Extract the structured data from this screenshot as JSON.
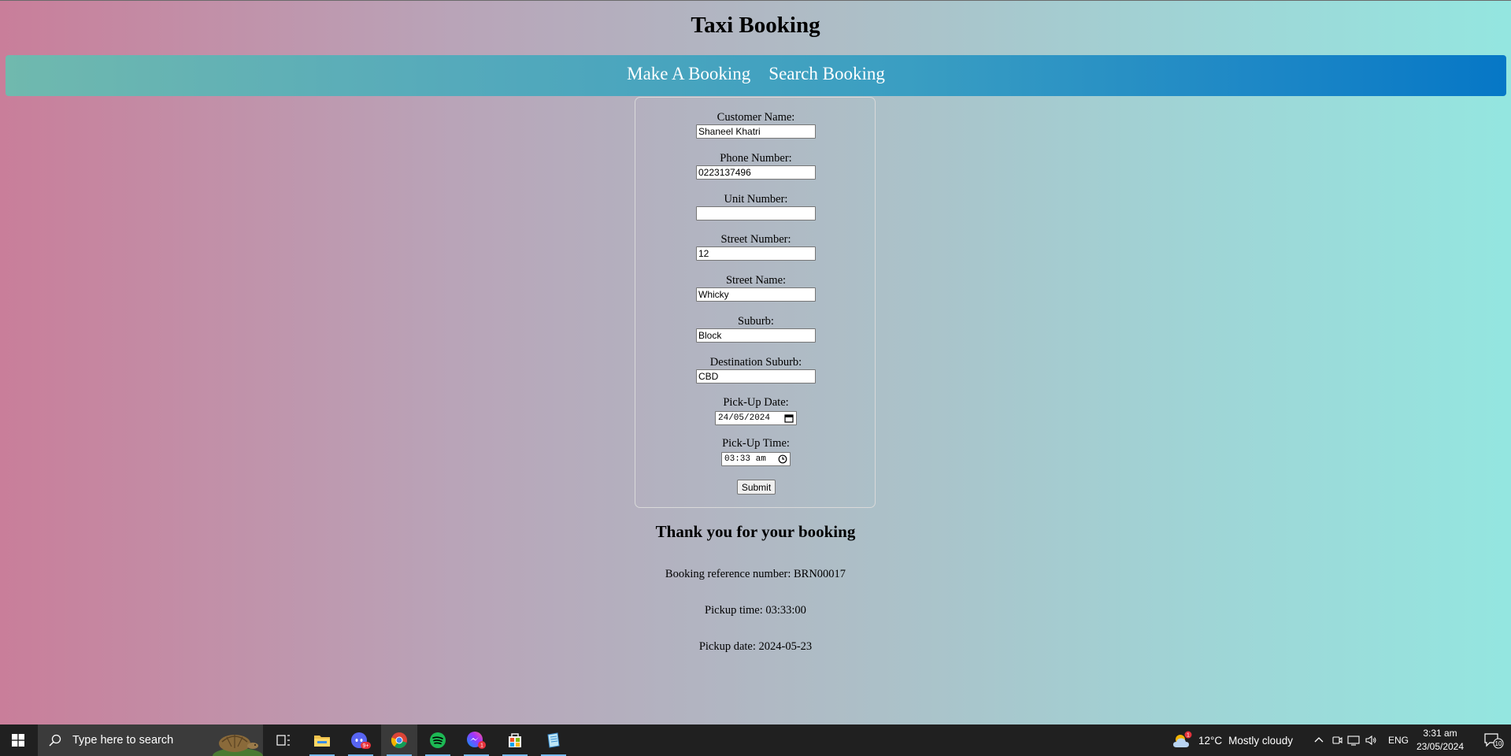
{
  "page": {
    "title": "Taxi Booking",
    "nav": {
      "make_booking": "Make A Booking",
      "search_booking": "Search Booking"
    }
  },
  "form": {
    "customer_name": {
      "label": "Customer Name:",
      "value": "Shaneel Khatri"
    },
    "phone_number": {
      "label": "Phone Number:",
      "value": "0223137496"
    },
    "unit_number": {
      "label": "Unit Number:",
      "value": ""
    },
    "street_number": {
      "label": "Street Number:",
      "value": "12"
    },
    "street_name": {
      "label": "Street Name:",
      "value": "Whicky"
    },
    "suburb": {
      "label": "Suburb:",
      "value": "Block"
    },
    "destination_suburb": {
      "label": "Destination Suburb:",
      "value": "CBD"
    },
    "pickup_date": {
      "label": "Pick-Up Date:",
      "value": "24/05/2024"
    },
    "pickup_time": {
      "label": "Pick-Up Time:",
      "value": "03:33 am"
    },
    "submit_label": "Submit"
  },
  "confirmation": {
    "heading": "Thank you for your booking",
    "reference": "Booking reference number: BRN00017",
    "pickup_time": "Pickup time: 03:33:00",
    "pickup_date": "Pickup date: 2024-05-23"
  },
  "taskbar": {
    "search_placeholder": "Type here to search",
    "apps": [
      "task-view",
      "file-explorer",
      "discord",
      "chrome",
      "spotify",
      "messenger",
      "store",
      "notepad"
    ],
    "discord_badge": "9+",
    "messenger_badge": "1",
    "weather": {
      "temp": "12°C",
      "condition": "Mostly cloudy",
      "badge": "1"
    },
    "language": "ENG",
    "time": "3:31 am",
    "date": "23/05/2024",
    "notification_count": "10"
  },
  "colors": {
    "nav_start": "#70b9ae",
    "nav_end": "#0677c6",
    "bg_left": "#c97e9a",
    "bg_right": "#94e6e0"
  }
}
